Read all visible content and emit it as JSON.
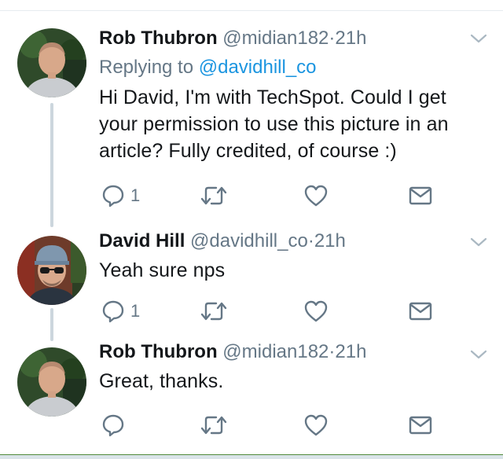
{
  "colors": {
    "link": "#1b95e0",
    "secondary_text": "#657786",
    "primary_text": "#14171a",
    "thread_line": "#ccd6dd"
  },
  "tweets": [
    {
      "name": "Rob Thubron",
      "handle": "@midian182",
      "dot": "·",
      "time": "21h",
      "replying_prefix": "Replying to ",
      "replying_to": "@davidhill_co",
      "text_lines": [
        "Hi David, I'm with TechSpot. Could I get",
        "your permission to use this picture in an",
        "article? Fully credited, of course :)"
      ],
      "reply_count": "1",
      "icons": [
        "reply-icon",
        "retweet-icon",
        "heart-icon",
        "envelope-icon",
        "chevron-down-icon"
      ]
    },
    {
      "name": "David Hill",
      "handle": "@davidhill_co",
      "dot": "·",
      "time": "21h",
      "text": "Yeah sure nps",
      "reply_count": "1",
      "icons": [
        "reply-icon",
        "retweet-icon",
        "heart-icon",
        "envelope-icon",
        "chevron-down-icon"
      ]
    },
    {
      "name": "Rob Thubron",
      "handle": "@midian182",
      "dot": "·",
      "time": "21h",
      "text": "Great, thanks.",
      "icons": [
        "reply-icon",
        "retweet-icon",
        "heart-icon",
        "envelope-icon",
        "chevron-down-icon"
      ]
    }
  ]
}
